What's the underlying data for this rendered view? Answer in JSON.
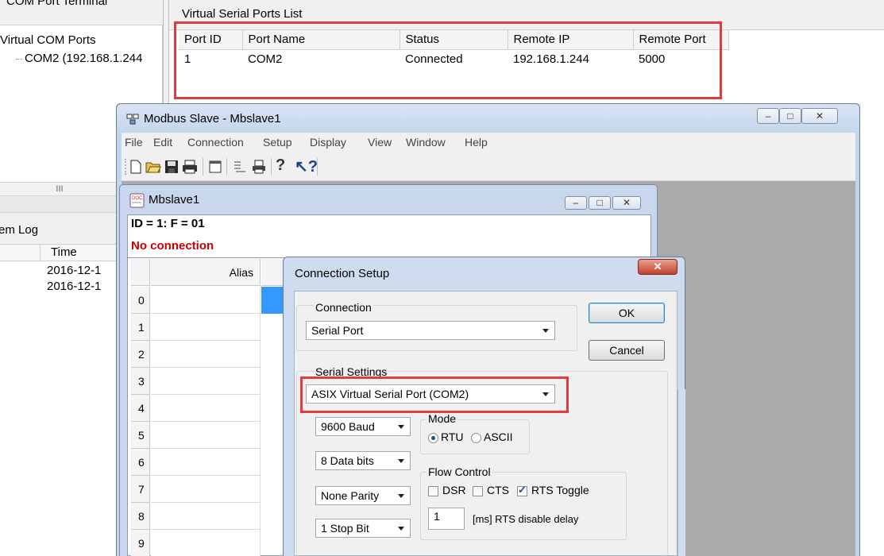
{
  "background_app": {
    "left_title": "COM Port Terminal",
    "tree_root": "Virtual COM Ports",
    "tree_item": "COM2 (192.168.1.244",
    "scroll_marker": "III",
    "log_title": "em Log",
    "log_col_time": "Time",
    "log_rows": [
      "2016-12-1",
      "2016-12-1"
    ]
  },
  "ports_panel": {
    "title": "Virtual Serial Ports List",
    "columns": [
      "Port ID",
      "Port Name",
      "Status",
      "Remote IP",
      "Remote Port"
    ],
    "rows": [
      {
        "port_id": "1",
        "port_name": "COM2",
        "status": "Connected",
        "remote_ip": "192.168.1.244",
        "remote_port": "5000"
      }
    ]
  },
  "modbus_window": {
    "title": "Modbus Slave - Mbslave1",
    "menu": [
      "File",
      "Edit",
      "Connection",
      "Setup",
      "Display",
      "View",
      "Window",
      "Help"
    ],
    "toolbar_icons": [
      "new-icon",
      "open-icon",
      "save-icon",
      "print-icon",
      "window-icon",
      "list-icon",
      "printer-icon",
      "help-icon",
      "context-help-icon"
    ],
    "controls": {
      "minimize": "–",
      "maximize": "□",
      "close": "✕"
    }
  },
  "child_window": {
    "title": "Mbslave1",
    "id_line": "ID = 1: F = 01",
    "status_line": "No connection",
    "status_color": "#cc0000",
    "grid_header_alias": "Alias",
    "row_numbers": [
      "0",
      "1",
      "2",
      "3",
      "4",
      "5",
      "6",
      "7",
      "8",
      "9"
    ],
    "selected_color": "#3399ff"
  },
  "dialog": {
    "title": "Connection Setup",
    "connection_group": "Connection",
    "connection_value": "Serial Port",
    "ok_label": "OK",
    "cancel_label": "Cancel",
    "serial_group": "Serial Settings",
    "port_value": "ASIX Virtual Serial Port (COM2)",
    "baud_value": "9600 Baud",
    "databits_value": "8 Data bits",
    "parity_value": "None Parity",
    "stopbit_value": "1 Stop Bit",
    "mode_group": "Mode",
    "mode_rtu": "RTU",
    "mode_ascii": "ASCII",
    "flow_group": "Flow Control",
    "flow_dsr": "DSR",
    "flow_cts": "CTS",
    "flow_rts": "RTS Toggle",
    "rts_delay_value": "1",
    "rts_delay_label": "[ms] RTS disable delay",
    "close_glyph": "✕"
  },
  "highlight_color": "#e23b3b"
}
